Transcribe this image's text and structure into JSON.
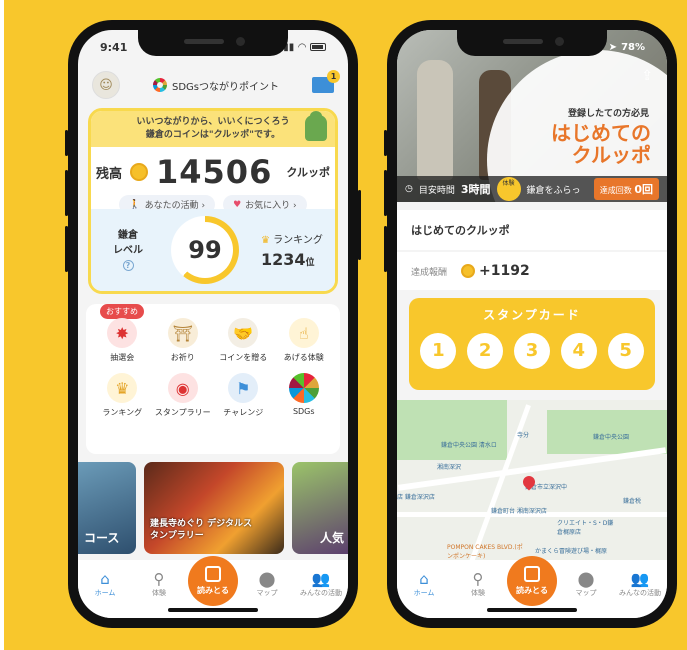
{
  "left_phone": {
    "status": {
      "time": "9:41"
    },
    "header": {
      "logo_text": "SDGsつながりポイント",
      "mail_badge": "1"
    },
    "banner": {
      "line1": "いいつながりから、いいくにつくろう",
      "line2": "鎌倉のコインは\"クルッポ\"です。"
    },
    "balance": {
      "label": "残高",
      "value": "14506",
      "unit": "クルッポ"
    },
    "pills": {
      "activity": "あなたの活動 ›",
      "favorites": "お気に入り ›"
    },
    "level": {
      "label_line1": "鎌倉",
      "label_line2": "レベル",
      "help": "?",
      "value": "99"
    },
    "ranking": {
      "label": "ランキング",
      "value": "1234",
      "unit": "位"
    },
    "recommend_tag": "おすすめ",
    "menu": [
      {
        "label": "抽選会",
        "icon": "lottery-icon"
      },
      {
        "label": "お祈り",
        "icon": "prayer-icon"
      },
      {
        "label": "コインを贈る",
        "icon": "handshake-icon"
      },
      {
        "label": "あげる体験",
        "icon": "experience-icon"
      },
      {
        "label": "ランキング",
        "icon": "crown-icon"
      },
      {
        "label": "スタンプラリー",
        "icon": "stamp-icon"
      },
      {
        "label": "チャレンジ",
        "icon": "challenge-icon"
      },
      {
        "label": "SDGs",
        "icon": "sdgs-icon"
      }
    ],
    "carousel": {
      "left_label": "コース",
      "center_label": "建長寺めぐり デジタルスタンプラリー",
      "right_label": "人気"
    }
  },
  "nav": {
    "home": "ホーム",
    "experience": "体験",
    "scan": "読みとる",
    "map": "マップ",
    "community": "みんなの活動"
  },
  "right_phone": {
    "status": {
      "battery": "78%"
    },
    "hero": {
      "subtitle": "登録したての方必見",
      "title_line1": "はじめての",
      "title_line2": "クルッポ",
      "duration_label": "目安時間",
      "duration_value": "3時間",
      "badge": "体験",
      "place": "鎌倉をふらっ",
      "count_label": "達成回数",
      "count_value": "0回"
    },
    "quest_title": "はじめてのクルッポ",
    "reward": {
      "label": "達成報酬",
      "value": "+1192"
    },
    "stamp_card": {
      "title": "スタンプカード",
      "stamps": [
        "1",
        "2",
        "3",
        "4",
        "5"
      ]
    },
    "map": {
      "labels": [
        "鎌倉中央公園 清水ロ",
        "鎌倉中央公園",
        "鎌倉市立深沢中",
        "湘南深沢",
        "鎌倉町台 湘南深沢店",
        "クリエイト・S・D鎌倉梶原店",
        "POMPON CAKES BLVD.(ポンポンケーキ)",
        "かまくら冒険遊び場・梶原",
        "寺分",
        "鎌倉税",
        "店 鎌倉深沢店"
      ]
    }
  }
}
